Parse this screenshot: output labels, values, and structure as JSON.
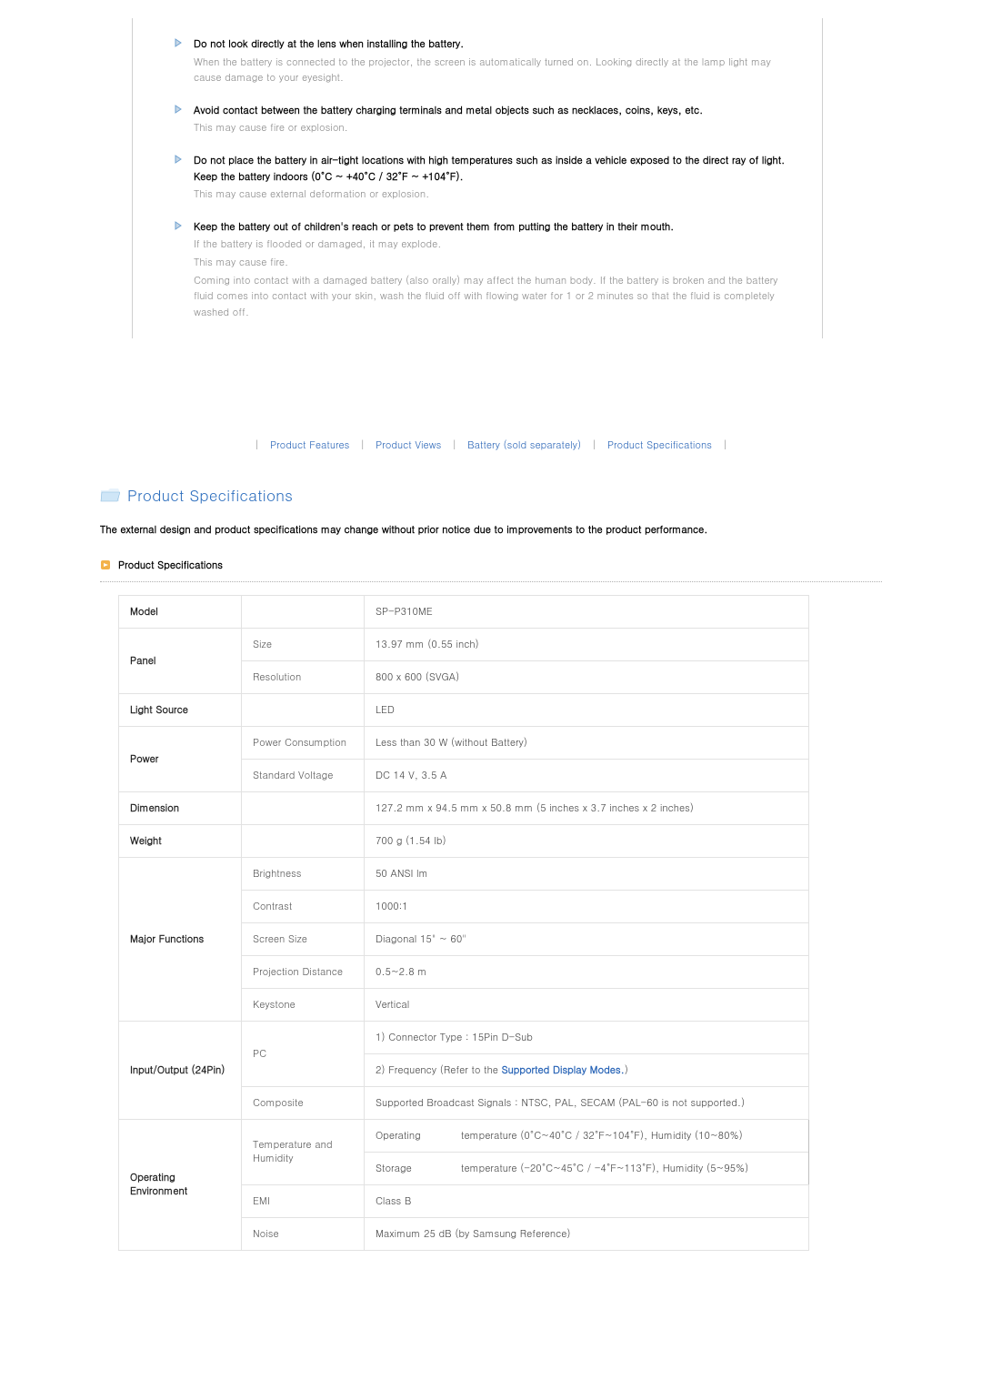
{
  "safety": [
    {
      "title": "Do not look directly at the lens when installing the battery.",
      "desc": [
        "When the battery is connected to the projector, the screen is automatically turned on. Looking directly at the lamp light may cause damage to your eyesight."
      ]
    },
    {
      "title": "Avoid contact between the battery charging terminals and metal objects such as necklaces, coins, keys, etc.",
      "desc": [
        "This may cause fire or explosion."
      ]
    },
    {
      "title": "Do not place the battery in air-tight locations with high temperatures such as inside a vehicle exposed to the direct ray of light. Keep the battery indoors (0°C ~ +40°C / 32°F ~ +104°F).",
      "desc": [
        "This may cause external deformation or explosion."
      ]
    },
    {
      "title": "Keep the battery out of children's reach or pets to prevent them from putting the battery in their mouth.",
      "desc": [
        "If the battery is flooded or damaged, it may explode.",
        "This may cause fire.",
        "Coming into contact with a damaged battery (also orally) may affect the human body. If the battery is broken and the battery fluid comes into contact with your skin, wash the fluid off with flowing water for 1 or 2 minutes so that the fluid is completely washed off."
      ]
    }
  ],
  "nav": {
    "features": "Product Features",
    "views": "Product Views",
    "battery": "Battery (sold separately)",
    "specs": "Product Specifications"
  },
  "section_title": "Product Specifications",
  "intro": "The external design and product specifications may change without prior notice due to improvements to the product performance.",
  "subheader": "Product Specifications",
  "spec": {
    "model_h": "Model",
    "model_v": "SP-P310ME",
    "panel_h": "Panel",
    "panel_size_h": "Size",
    "panel_size_v": "13.97 mm (0.55 inch)",
    "panel_res_h": "Resolution",
    "panel_res_v": "800 x 600 (SVGA)",
    "light_h": "Light Source",
    "light_v": "LED",
    "power_h": "Power",
    "power_cons_h": "Power Consumption",
    "power_cons_v": "Less than 30 W (without Battery)",
    "power_std_h": "Standard Voltage",
    "power_std_v": "DC 14 V, 3.5 A",
    "dim_h": "Dimension",
    "dim_v": "127.2 mm x 94.5 mm x 50.8 mm (5 inches x 3.7 inches x 2 inches)",
    "weight_h": "Weight",
    "weight_v": "700 g (1.54 lb)",
    "major_h": "Major Functions",
    "bright_h": "Brightness",
    "bright_v": "50 ANSI lm",
    "contrast_h": "Contrast",
    "contrast_v": "1000:1",
    "screen_h": "Screen Size",
    "screen_v": "Diagonal 15\" ~ 60\"",
    "proj_h": "Projection Distance",
    "proj_v": "0.5~2.8 m",
    "keystone_h": "Keystone",
    "keystone_v": "Vertical",
    "io_h": "Input/Output (24Pin)",
    "pc_h": "PC",
    "pc_v1": "1) Connector Type : 15Pin D-Sub",
    "pc_v2a": "2) Frequency (Refer to the ",
    "pc_link": "Supported Display Modes.",
    "pc_v2b": ")",
    "comp_h": "Composite",
    "comp_v": "Supported Broadcast Signals : NTSC, PAL, SECAM (PAL-60 is not supported.)",
    "env_h": "Operating Environment",
    "temp_h": "Temperature and Humidity",
    "temp_op_h": "Operating",
    "temp_op_v": "temperature (0°C~40°C / 32°F~104°F), Humidity (10~80%)",
    "temp_st_h": "Storage",
    "temp_st_v": "temperature (-20°C~45°C / -4°F~113°F), Humidity (5~95%)",
    "emi_h": "EMI",
    "emi_v": "Class B",
    "noise_h": "Noise",
    "noise_v": "Maximum 25 dB (by Samsung Reference)"
  }
}
